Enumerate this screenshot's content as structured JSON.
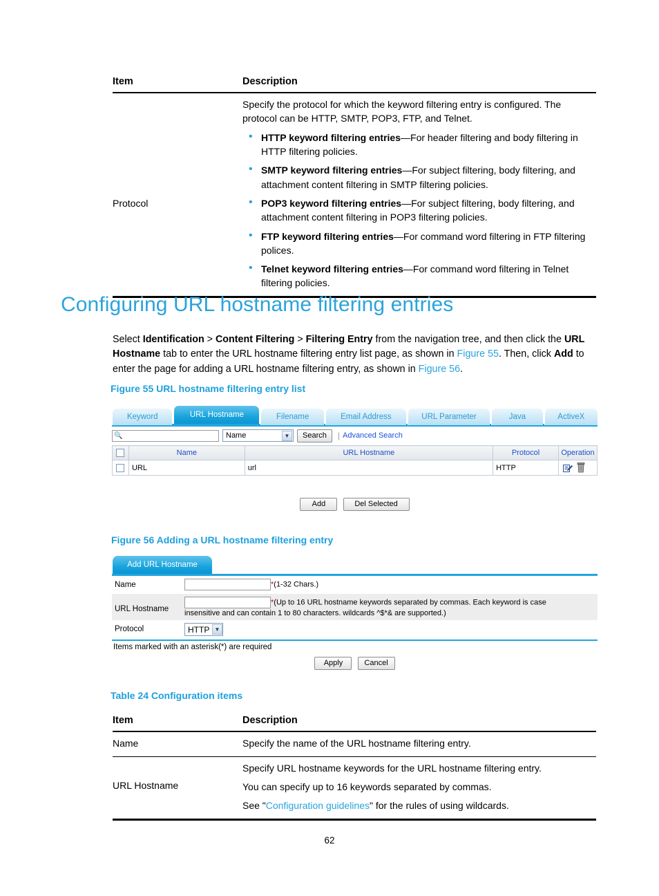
{
  "top_table": {
    "headers": {
      "item": "Item",
      "description": "Description"
    },
    "rows": [
      {
        "item": "Protocol",
        "intro": "Specify the protocol for which the keyword filtering entry is configured. The protocol can be HTTP, SMTP, POP3, FTP, and Telnet.",
        "bullets": [
          {
            "term": "HTTP keyword filtering entries",
            "text": "—For header filtering and body filtering in HTTP filtering policies."
          },
          {
            "term": "SMTP keyword filtering entries",
            "text": "—For subject filtering, body filtering, and attachment content filtering in SMTP filtering policies."
          },
          {
            "term": "POP3 keyword filtering entries",
            "text": "—For subject filtering, body filtering, and attachment content filtering in POP3 filtering policies."
          },
          {
            "term": "FTP keyword filtering entries",
            "text": "—For command word filtering in FTP filtering polices."
          },
          {
            "term": "Telnet keyword filtering entries",
            "text": "—For command word filtering in Telnet filtering policies."
          }
        ]
      }
    ]
  },
  "section": {
    "title": "Configuring URL hostname filtering entries",
    "paragraph": {
      "p1": "Select ",
      "b1": "Identification",
      "p2": " > ",
      "b2": "Content Filtering",
      "p3": " > ",
      "b3": "Filtering Entry",
      "p4": " from the navigation tree, and then click the ",
      "b4": "URL Hostname",
      "p5": " tab to enter the URL hostname filtering entry list page, as shown in ",
      "link1": "Figure 55",
      "p6": ". Then, click ",
      "b5": "Add",
      "p7": " to enter the page for adding a URL hostname filtering entry, as shown in ",
      "link2": "Figure 56",
      "p8": "."
    }
  },
  "figure55": {
    "caption": "Figure 55 URL hostname filtering entry list",
    "tabs": [
      {
        "label": "Keyword",
        "active": false
      },
      {
        "label": "URL Hostname",
        "active": true
      },
      {
        "label": "Filename",
        "active": false
      },
      {
        "label": "Email Address",
        "active": false
      },
      {
        "label": "URL Parameter",
        "active": false
      },
      {
        "label": "Java",
        "active": false
      },
      {
        "label": "ActiveX",
        "active": false
      }
    ],
    "search": {
      "input_value": "",
      "field_select": "Name",
      "search_button": "Search",
      "advanced_search": "Advanced Search",
      "magnifier_icon": "search-icon"
    },
    "grid": {
      "headers": [
        "",
        "Name",
        "URL Hostname",
        "Protocol",
        "Operation"
      ],
      "rows": [
        {
          "name": "URL",
          "hostname": "url",
          "protocol": "HTTP",
          "operations": [
            "edit-icon",
            "delete-icon"
          ]
        }
      ]
    },
    "buttons": {
      "add": "Add",
      "del_selected": "Del Selected"
    }
  },
  "figure56": {
    "caption": "Figure 56 Adding a URL hostname filtering entry",
    "tab_label": "Add URL Hostname",
    "fields": [
      {
        "label": "Name",
        "value": "",
        "required_mark": "*",
        "hint": "(1-32 Chars.)"
      },
      {
        "label": "URL Hostname",
        "value": "",
        "required_mark": "*",
        "hint": "(Up to 16 URL hostname keywords separated by commas. Each keyword is case",
        "hint2": "insensitive and can contain 1 to 80 characters. wildcards ^$*& are supported.)"
      },
      {
        "label": "Protocol",
        "value": "HTTP",
        "required_mark": "",
        "hint": ""
      }
    ],
    "note": "Items marked with an asterisk(*) are required",
    "buttons": {
      "apply": "Apply",
      "cancel": "Cancel"
    }
  },
  "table24": {
    "caption": "Table 24 Configuration items",
    "headers": {
      "item": "Item",
      "description": "Description"
    },
    "rows": [
      {
        "item": "Name",
        "lines": [
          "Specify the name of the URL hostname filtering entry."
        ]
      },
      {
        "item": "URL Hostname",
        "lines": [
          "Specify URL hostname keywords for the URL hostname filtering entry.",
          "You can specify up to 16 keywords separated by commas."
        ],
        "see_prefix": "See \"",
        "see_link": "Configuration guidelines",
        "see_suffix": "\" for the rules of using wildcards."
      }
    ]
  },
  "footer": {
    "page_number": "62"
  },
  "colors": {
    "heading_blue": "#2aa3dd",
    "link_blue": "#29a3dd",
    "bullet_blue": "#2b9fd8",
    "tab_active": "#18a4dd",
    "grid_header_text": "#1d4fc4",
    "required_red": "#d40000"
  }
}
